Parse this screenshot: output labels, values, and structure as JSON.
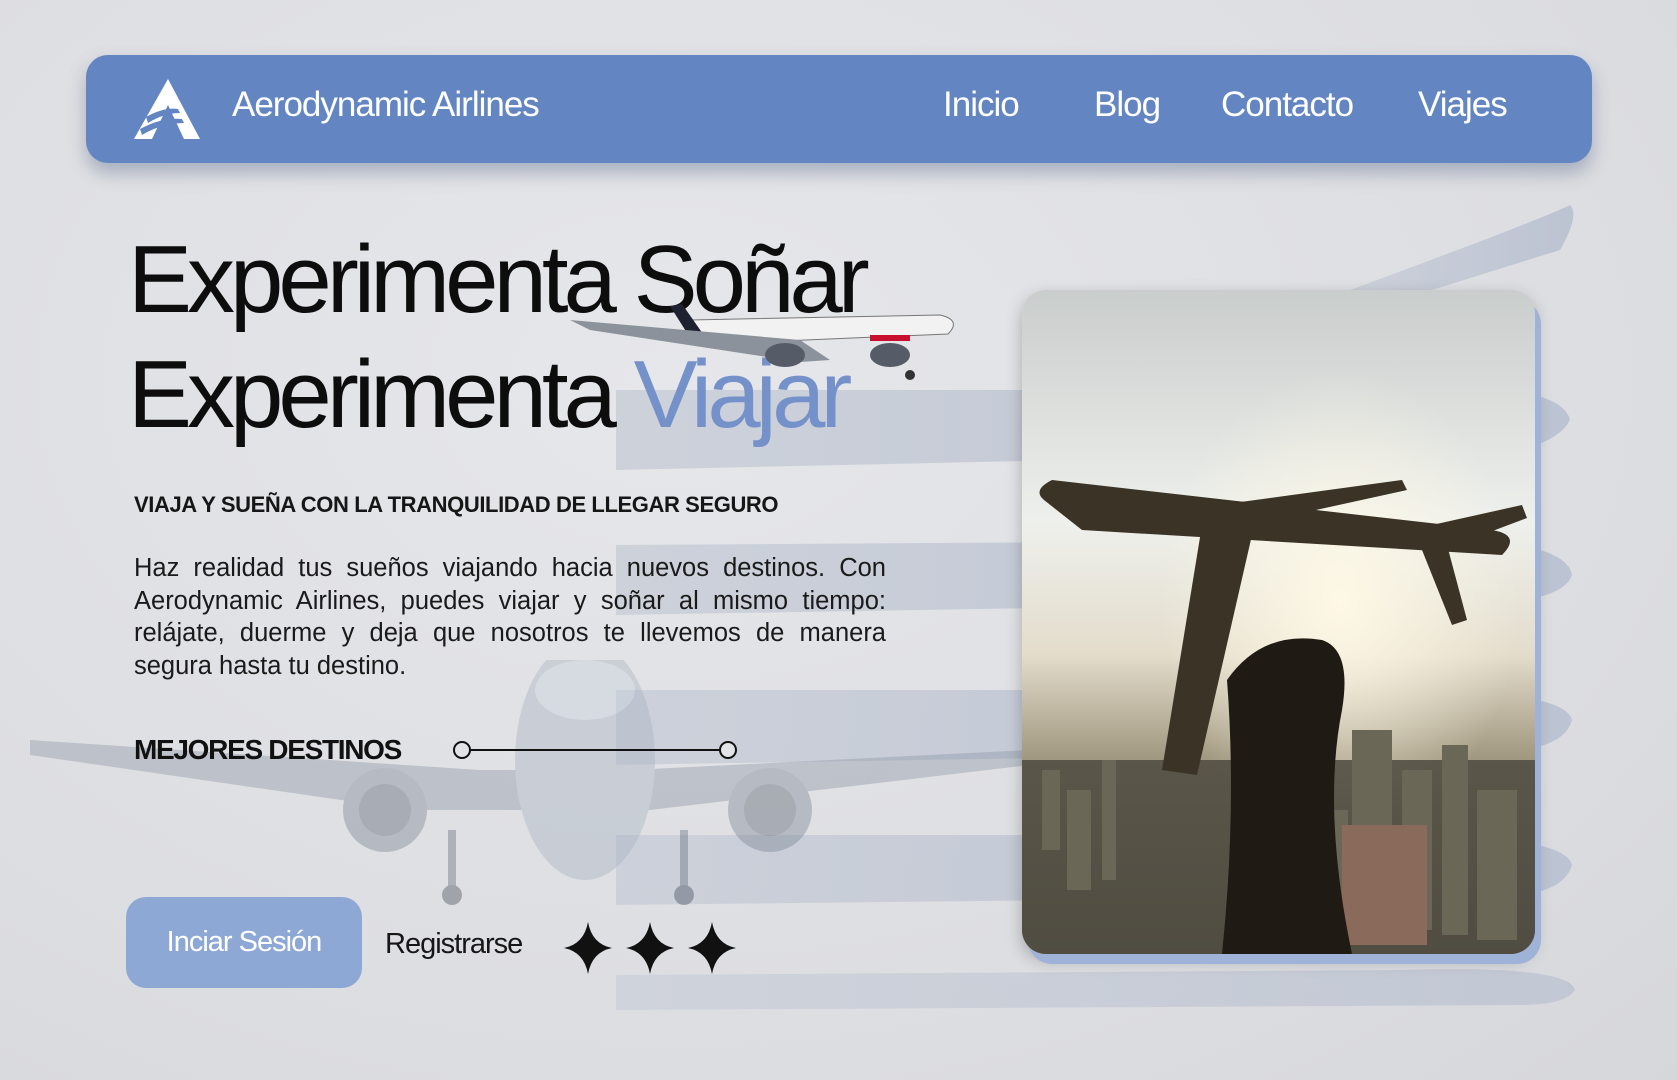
{
  "brand": {
    "name": "Aerodynamic Airlines",
    "logo_icon": "airline-a-logo-icon"
  },
  "nav": {
    "items": [
      {
        "label": "Inicio"
      },
      {
        "label": "Blog"
      },
      {
        "label": "Contacto"
      },
      {
        "label": "Viajes"
      }
    ]
  },
  "hero": {
    "line1": "Experimenta Soñar",
    "line2_main": "Experimenta ",
    "line2_accent": "Viajar",
    "subtitle": "VIAJA Y SUEÑA CON LA TRANQUILIDAD DE LLEGAR SEGURO",
    "description": "Haz realidad tus sueños viajando hacia nuevos destinos. Con Aerodynamic Airlines, puedes viajar y soñar al mismo tiempo: relájate, duerme y deja que nosotros te llevemos de manera segura hasta tu destino.",
    "destinations_label": "MEJORES DESTINOS"
  },
  "actions": {
    "login": "Inciar Sesión",
    "register": "Registrarse"
  },
  "colors": {
    "accent": "#6386c2",
    "accent_text": "#7491c9",
    "button": "#8ea8d6",
    "background": "#dcdde1"
  }
}
